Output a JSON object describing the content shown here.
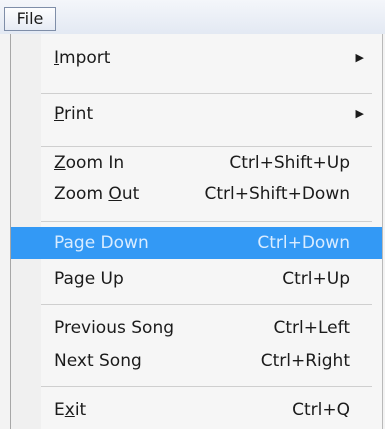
{
  "menubar": {
    "file_label": "File"
  },
  "menu": {
    "import": {
      "pre": "",
      "key": "I",
      "post": "mport"
    },
    "print": {
      "pre": "",
      "key": "P",
      "post": "rint"
    },
    "zoom_in": {
      "pre": "",
      "key": "Z",
      "post": "oom In",
      "shortcut": "Ctrl+Shift+Up"
    },
    "zoom_out": {
      "pre": "Zoom ",
      "key": "O",
      "post": "ut",
      "shortcut": "Ctrl+Shift+Down"
    },
    "page_down": {
      "label": "Page Down",
      "shortcut": "Ctrl+Down"
    },
    "page_up": {
      "label": "Page Up",
      "shortcut": "Ctrl+Up"
    },
    "previous_song": {
      "label": "Previous Song",
      "shortcut": "Ctrl+Left"
    },
    "next_song": {
      "label": "Next Song",
      "shortcut": "Ctrl+Right"
    },
    "exit": {
      "pre": "E",
      "key": "x",
      "post": "it",
      "shortcut": "Ctrl+Q"
    }
  },
  "icons": {
    "submenu_arrow": "triangle-right"
  },
  "colors": {
    "highlight": "#3399f5",
    "highlight_text": "#d9ecff"
  }
}
